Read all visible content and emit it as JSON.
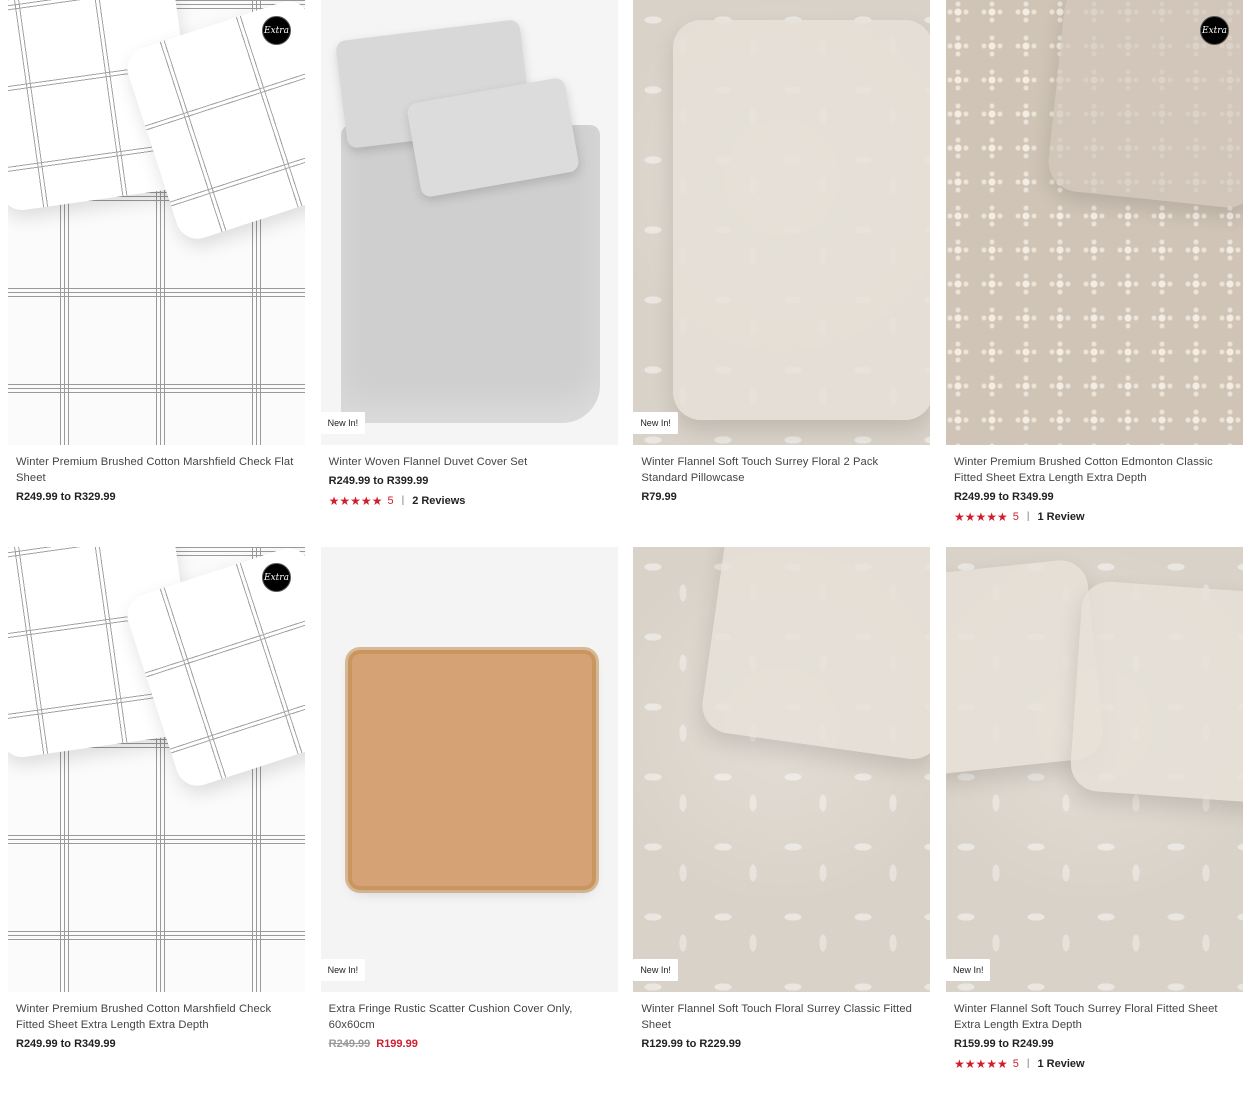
{
  "products": [
    {
      "name": "Winter Premium Brushed Cotton Marshfield Check Flat Sheet",
      "price": "R249.99 to R329.99",
      "badge_extra": "Extra",
      "badge_new": null,
      "rating": null,
      "reviews": null,
      "image": "plaid"
    },
    {
      "name": "Winter Woven Flannel Duvet Cover Set",
      "price": "R249.99 to R399.99",
      "badge_extra": null,
      "badge_new": "New In!",
      "rating": "5",
      "reviews": "2 Reviews",
      "image": "duvet"
    },
    {
      "name": "Winter Flannel Soft Touch Surrey Floral 2 Pack Standard Pillowcase",
      "price": "R79.99",
      "badge_extra": null,
      "badge_new": "New In!",
      "rating": null,
      "reviews": null,
      "image": "floral-pillowcase"
    },
    {
      "name": "Winter Premium Brushed Cotton Edmonton Classic Fitted Sheet Extra Length Extra Depth",
      "price": "R249.99 to R349.99",
      "badge_extra": "Extra",
      "badge_new": null,
      "rating": "5",
      "reviews": "1 Review",
      "image": "beige-star"
    },
    {
      "name": "Winter Premium Brushed Cotton Marshfield Check Fitted Sheet Extra Length Extra Depth",
      "price": "R249.99 to R349.99",
      "badge_extra": "Extra",
      "badge_new": null,
      "rating": null,
      "reviews": null,
      "image": "plaid"
    },
    {
      "name": "Extra Fringe Rustic Scatter Cushion Cover Only, 60x60cm",
      "price_was": "R249.99",
      "price_now": "R199.99",
      "badge_extra": null,
      "badge_new": "New In!",
      "rating": null,
      "reviews": null,
      "image": "cushion"
    },
    {
      "name": "Winter Flannel Soft Touch Floral Surrey Classic Fitted Sheet",
      "price": "R129.99 to R229.99",
      "badge_extra": null,
      "badge_new": "New In!",
      "rating": null,
      "reviews": null,
      "image": "floral-sheet"
    },
    {
      "name": "Winter Flannel Soft Touch Surrey Floral Fitted Sheet Extra Length Extra Depth",
      "price": "R159.99 to R249.99",
      "badge_extra": null,
      "badge_new": "New In!",
      "rating": "5",
      "reviews": "1 Review",
      "image": "floral-sheet"
    }
  ],
  "colors": {
    "sale_red": "#d11d2d",
    "rating_red": "#d11d2d",
    "text": "#444444"
  },
  "icons": {
    "star": "star-icon",
    "extra_badge": "extra-logo-icon"
  }
}
